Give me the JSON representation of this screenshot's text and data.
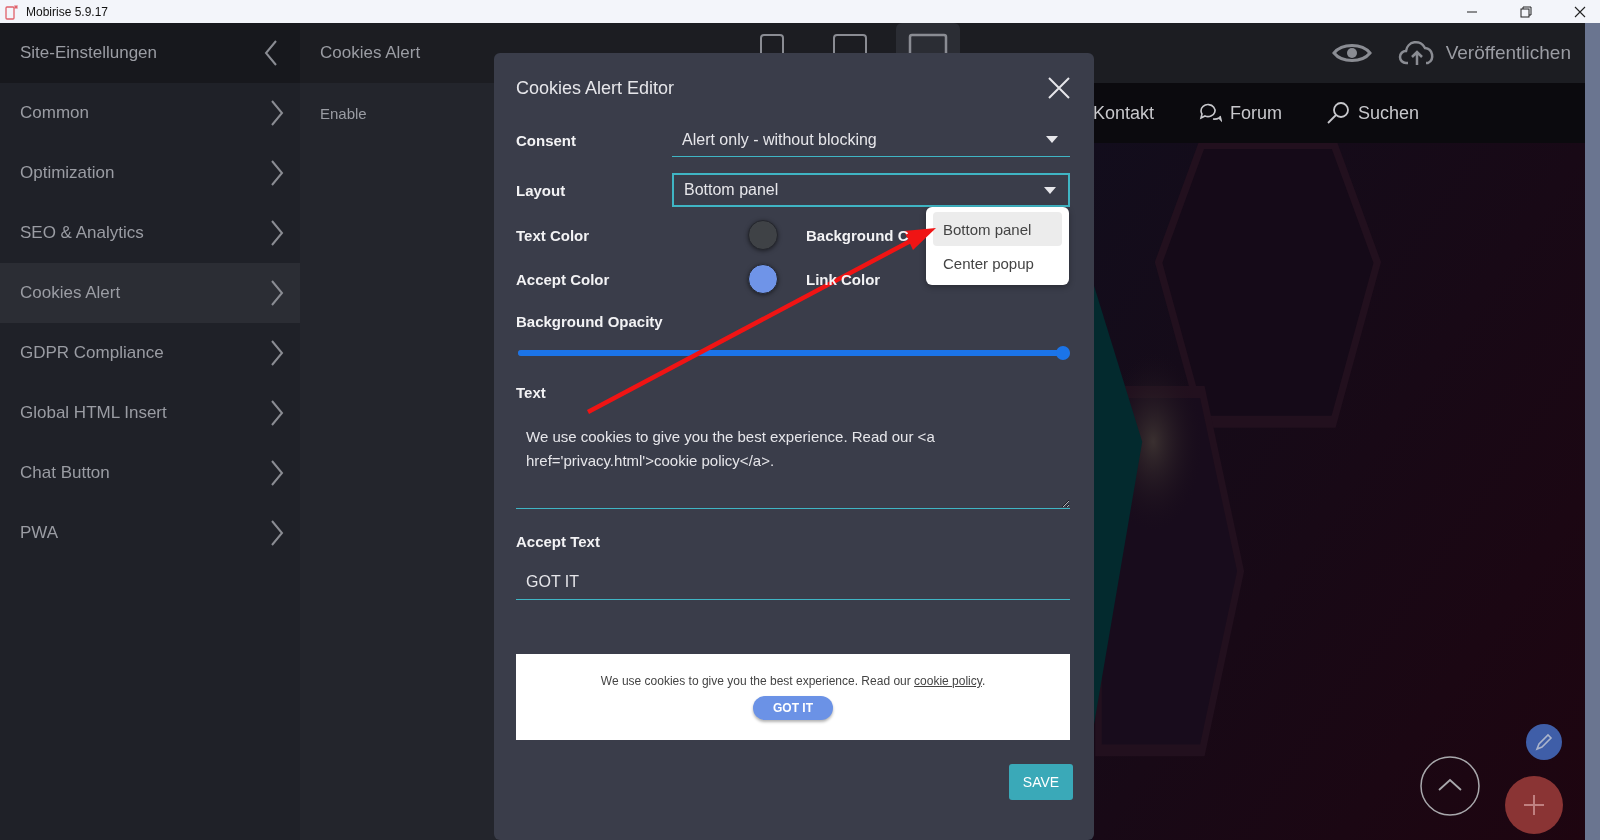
{
  "window": {
    "title": "Mobirise 5.9.17"
  },
  "sidebar": {
    "title": "Site-Einstellungen",
    "items": [
      {
        "label": "Common",
        "selected": false
      },
      {
        "label": "Optimization",
        "selected": false
      },
      {
        "label": "SEO & Analytics",
        "selected": false
      },
      {
        "label": "Cookies Alert",
        "selected": true
      },
      {
        "label": "GDPR Compliance",
        "selected": false
      },
      {
        "label": "Global HTML Insert",
        "selected": false
      },
      {
        "label": "Chat Button",
        "selected": false
      },
      {
        "label": "PWA",
        "selected": false
      }
    ]
  },
  "subpanel": {
    "title": "Cookies Alert",
    "items": [
      "Enable"
    ]
  },
  "toolbar": {
    "devices": [
      {
        "kind": "phone",
        "selected": false
      },
      {
        "kind": "tablet",
        "selected": false
      },
      {
        "kind": "desktop",
        "selected": true
      }
    ],
    "publish": "Veröffentlichen"
  },
  "site_nav": [
    {
      "kind": "text",
      "label": "Kontakt"
    },
    {
      "kind": "chat",
      "label": "Forum"
    },
    {
      "kind": "search",
      "label": "Suchen"
    }
  ],
  "editor": {
    "title": "Cookies Alert Editor",
    "consent": {
      "label": "Consent",
      "value": "Alert only - without blocking"
    },
    "layout": {
      "label": "Layout",
      "value": "Bottom panel",
      "options": [
        {
          "label": "Bottom panel",
          "selected": true
        },
        {
          "label": "Center popup",
          "selected": false
        }
      ]
    },
    "colors": [
      {
        "label": "Text Color",
        "color": "#3f4246"
      },
      {
        "label": "Background C"
      },
      {
        "label": "Accept Color",
        "color": "#6f94e8"
      },
      {
        "label": "Link Color"
      }
    ],
    "opacity": {
      "label": "Background Opacity",
      "level": 1
    },
    "text": {
      "label": "Text",
      "value": "We use cookies to give you the best experience. Read our <a href='privacy.html'>cookie policy</a>."
    },
    "accept_text": {
      "label": "Accept Text",
      "value": "GOT IT"
    },
    "preview": {
      "message": "We use cookies to give you the best experience. Read our ",
      "link": "cookie policy",
      "end": ".",
      "button": "GOT IT"
    },
    "save": "SAVE"
  }
}
